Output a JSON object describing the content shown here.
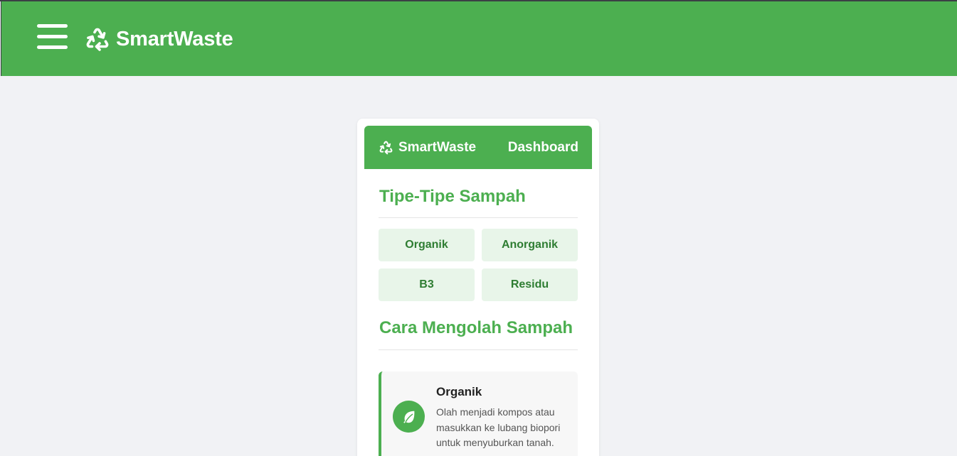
{
  "topbar": {
    "menu_icon": "hamburger-menu-icon",
    "logo_icon": "recycle-icon",
    "brand": "SmartWaste"
  },
  "card": {
    "header": {
      "logo_icon": "recycle-icon",
      "brand": "SmartWaste",
      "dashboard_link": "Dashboard"
    },
    "types_section": {
      "title": "Tipe-Tipe Sampah",
      "types": [
        "Organik",
        "Anorganik",
        "B3",
        "Residu"
      ]
    },
    "processing_section": {
      "title": "Cara Mengolah Sampah",
      "items": [
        {
          "icon": "leaf-icon",
          "title": "Organik",
          "description": "Olah menjadi kompos atau masukkan ke lubang biopori untuk menyuburkan tanah."
        }
      ]
    }
  },
  "colors": {
    "primary": "#4caf50",
    "type_button_bg": "#e8f5e9",
    "type_button_text": "#2e7d32",
    "page_bg": "#f1f2f5"
  }
}
